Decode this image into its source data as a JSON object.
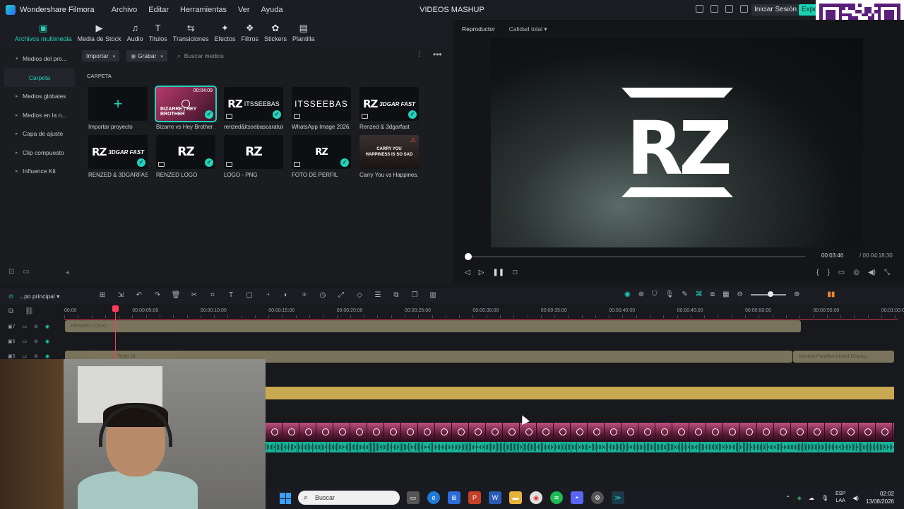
{
  "app": {
    "name": "Wondershare Filmora",
    "window_title": "VIDEOS MASHUP",
    "menu": [
      "Archivo",
      "Editar",
      "Herramientas",
      "Ver",
      "Ayuda"
    ],
    "login_label": "Iniciar Sesión",
    "export_label": "Expo"
  },
  "qr": {
    "badge": "yape"
  },
  "tabs": [
    {
      "label": "Archivos multimedia",
      "icon": "media-icon",
      "active": true
    },
    {
      "label": "Media de Stock",
      "icon": "stock-icon"
    },
    {
      "label": "Audio",
      "icon": "audio-icon"
    },
    {
      "label": "Titulos",
      "icon": "titles-icon"
    },
    {
      "label": "Transiciones",
      "icon": "transitions-icon"
    },
    {
      "label": "Efectos",
      "icon": "effects-icon"
    },
    {
      "label": "Filtros",
      "icon": "filters-icon"
    },
    {
      "label": "Stickers",
      "icon": "stickers-icon"
    },
    {
      "label": "Plantilla",
      "icon": "template-icon"
    }
  ],
  "sidebar": {
    "items": [
      {
        "label": "Medios del pro...",
        "expanded": true
      },
      {
        "label": "Carpeta",
        "active": true
      },
      {
        "label": "Medios globales"
      },
      {
        "label": "Medios en la n..."
      },
      {
        "label": "Capa de ajuste"
      },
      {
        "label": "Clip compuesto"
      },
      {
        "label": "Influence Kit"
      }
    ]
  },
  "media_toolbar": {
    "import_label": "Importar",
    "record_label": "Grabar",
    "search_placeholder": "Buscar medios"
  },
  "folder_label": "CARPETA",
  "media_items": [
    {
      "name": "Importar proyecto",
      "kind": "import"
    },
    {
      "name": "Bizarre vs Hey Brother ...",
      "kind": "video",
      "duration": "00:04:09",
      "selected": true,
      "checked": true
    },
    {
      "name": "renzed&itssebascaratula",
      "kind": "image",
      "checked": true,
      "thumb": "RZ ITSSEEBAS"
    },
    {
      "name": "WhatsApp Image 2026...",
      "kind": "image",
      "thumb": "ITSSEEBAS"
    },
    {
      "name": "Renzed & 3dgarfast",
      "kind": "image",
      "checked": true,
      "thumb": "RZ 3DGAR FAST"
    },
    {
      "name": "RENZED & 3DGARFAS...",
      "kind": "image",
      "checked": true,
      "thumb": "RZ 3DGAR FAST"
    },
    {
      "name": "RENZED LOGO",
      "kind": "image",
      "checked": true,
      "thumb": "RZ"
    },
    {
      "name": "LOGO - PNG",
      "kind": "image",
      "thumb": "RZ"
    },
    {
      "name": "FOTO DE PERFIL",
      "kind": "image",
      "checked": true,
      "thumb": "RZ"
    },
    {
      "name": "Carry You vs Happines...",
      "kind": "video",
      "warning": true,
      "thumb": "CARRY YOU HAPPINESS IS SO SAD"
    }
  ],
  "player": {
    "tab_label": "Reproductor",
    "quality_label": "Calidad total",
    "current_time": "00:03:46",
    "total_time": "/ 00:04:18:30",
    "progress": 0.005,
    "logo_text": "RZ"
  },
  "timeline": {
    "track_label": "...po principal",
    "ticks": [
      "00:00",
      "00:00:05:00",
      "00:00:10:00",
      "00:00:15:00",
      "00:00:20:00",
      "00:00:25:00",
      "00:00:30:00",
      "00:00:35:00",
      "00:00:40:00",
      "00:00:45:00",
      "00:00:50:00",
      "00:00:55:00",
      "00:01:00:00"
    ],
    "track_numbers": [
      "7",
      "6",
      "5"
    ],
    "clip_labels": [
      "RENZED LOGO",
      "Texto 01",
      "Vertical Parallax Kinect Display..."
    ]
  },
  "taskbar": {
    "search_placeholder": "Buscar",
    "lang_top": "ESP",
    "lang_bottom": "LAA",
    "time": "02:02",
    "date": "13/08/2026"
  }
}
